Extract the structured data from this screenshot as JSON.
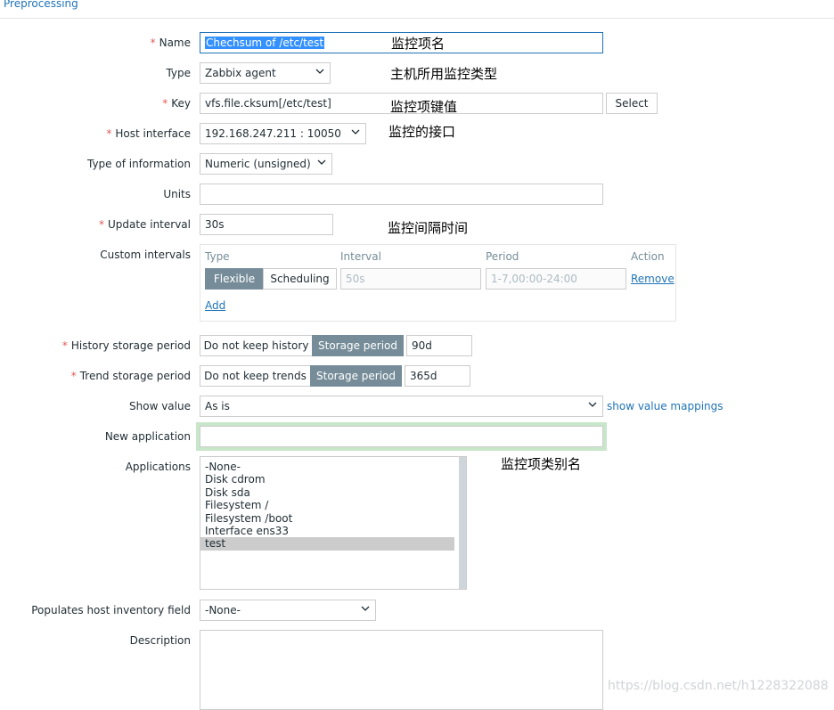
{
  "tab": {
    "label": "Preprocessing"
  },
  "form": {
    "name": {
      "label": "Name",
      "value": "Chechsum of /etc/test",
      "note": "监控项名"
    },
    "type": {
      "label": "Type",
      "value": "Zabbix agent",
      "note": "主机所用监控类型"
    },
    "key": {
      "label": "Key",
      "value": "vfs.file.cksum[/etc/test]",
      "note": "监控项键值",
      "select_label": "Select"
    },
    "host_interface": {
      "label": "Host interface",
      "value": "192.168.247.211 : 10050",
      "note": "监控的接口"
    },
    "type_of_information": {
      "label": "Type of information",
      "value": "Numeric (unsigned)"
    },
    "units": {
      "label": "Units",
      "value": ""
    },
    "update_interval": {
      "label": "Update interval",
      "value": "30s",
      "note": "监控间隔时间"
    },
    "custom_intervals": {
      "label": "Custom intervals",
      "headers": {
        "type": "Type",
        "interval": "Interval",
        "period": "Period",
        "action": "Action"
      },
      "flexible_label": "Flexible",
      "scheduling_label": "Scheduling",
      "interval_placeholder": "50s",
      "period_placeholder": "1-7,00:00-24:00",
      "remove_label": "Remove",
      "add_label": "Add"
    },
    "history": {
      "label": "History storage period",
      "option_off": "Do not keep history",
      "option_on": "Storage period",
      "value": "90d"
    },
    "trend": {
      "label": "Trend storage period",
      "option_off": "Do not keep trends",
      "option_on": "Storage period",
      "value": "365d"
    },
    "show_value": {
      "label": "Show value",
      "value": "As is",
      "link": "show value mappings"
    },
    "new_application": {
      "label": "New application",
      "value": ""
    },
    "applications": {
      "label": "Applications",
      "note": "监控项类别名",
      "items": [
        "-None-",
        "Disk cdrom",
        "Disk sda",
        "Filesystem /",
        "Filesystem /boot",
        "Interface ens33",
        "test"
      ]
    },
    "inventory": {
      "label": "Populates host inventory field",
      "value": "-None-"
    },
    "description": {
      "label": "Description",
      "value": ""
    }
  },
  "watermark": "https://blog.csdn.net/h1228322088",
  "colors": {
    "accent": "#1f73b7",
    "active_toggle": "#768d99",
    "required": "#e45959",
    "focus_green": "#c8e6c9"
  }
}
